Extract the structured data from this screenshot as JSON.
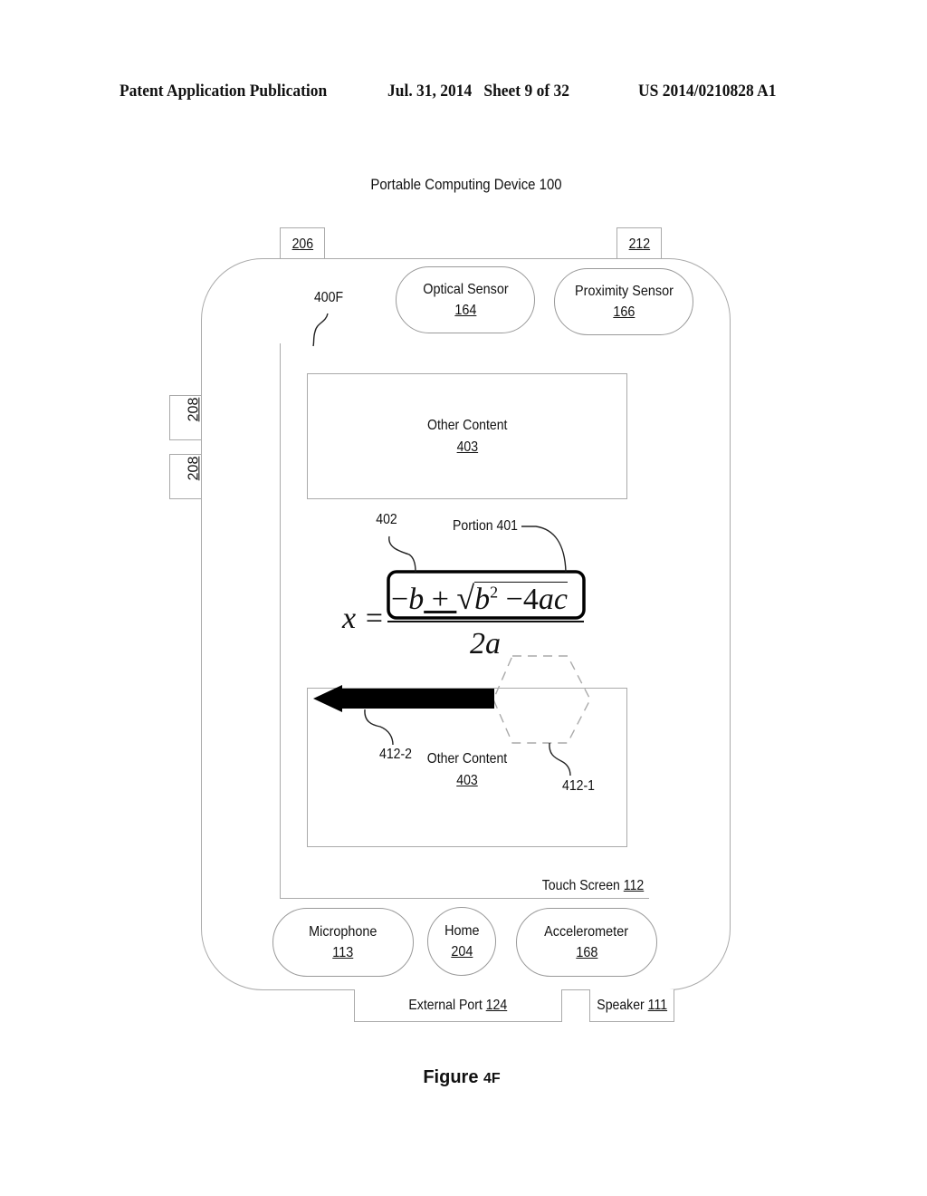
{
  "header": {
    "publication": "Patent Application Publication",
    "date_sheet": "Jul. 31, 2014   Sheet 9 of 32",
    "number": "US 2014/0210828 A1"
  },
  "device": {
    "title": "Portable Computing Device 100",
    "top_buttons": [
      {
        "ref": "206"
      },
      {
        "ref": "212"
      }
    ],
    "side_buttons": [
      {
        "ref": "208"
      },
      {
        "ref": "208"
      }
    ],
    "sensors": [
      {
        "name": "Optical Sensor",
        "ref": "164"
      },
      {
        "name": "Proximity Sensor",
        "ref": "166"
      }
    ],
    "screen_label": "400F",
    "touch_screen": {
      "name": "Touch Screen",
      "ref": "112"
    },
    "bottom_controls": [
      {
        "name": "Microphone",
        "ref": "113"
      },
      {
        "name": "Home",
        "ref": "204"
      },
      {
        "name": "Accelerometer",
        "ref": "168"
      }
    ],
    "external_port": {
      "name": "External Port",
      "ref": "124"
    },
    "speaker": {
      "name": "Speaker",
      "ref": "111"
    }
  },
  "content": {
    "top_block": {
      "name": "Other Content",
      "ref": "403"
    },
    "bottom_block": {
      "name": "Other Content",
      "ref": "403"
    },
    "formula": {
      "lhs": "x =",
      "numerator": "−b ± √b² − 4ac",
      "numerator_parts": {
        "minus_b": "−b",
        "pm": "±",
        "b": "b",
        "exp": "2",
        "rest": "− 4ac"
      },
      "denominator": "2a"
    },
    "callouts": {
      "portion": "Portion 401",
      "box_ref": "402",
      "gesture_start": "412-1",
      "gesture_end": "412-2"
    }
  },
  "figure_caption": {
    "prefix": "Figure ",
    "id": "4F"
  }
}
